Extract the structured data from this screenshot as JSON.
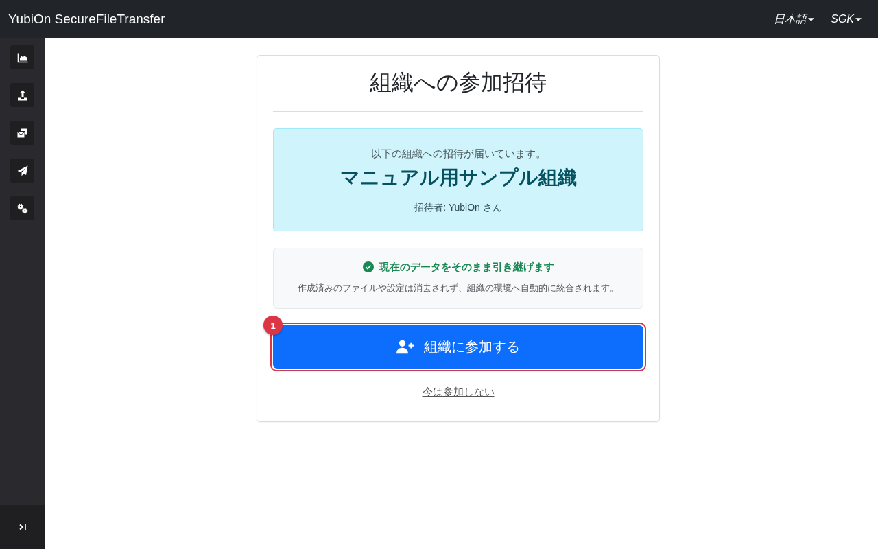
{
  "topbar": {
    "title": "YubiOn SecureFileTransfer",
    "menus": [
      {
        "label": "日本語"
      },
      {
        "label": "SGK"
      }
    ]
  },
  "card": {
    "title": "組織への参加招待",
    "invitation": {
      "intro": "以下の組織への招待が届いています。",
      "organization": "マニュアル用サンプル組織",
      "inviter": "招待者: YubiOn さん"
    },
    "notice": {
      "heading": "現在のデータをそのまま引き継げます",
      "text": "作成済みのファイルや設定は消去されず、組織の環境へ自動的に統合されます。"
    },
    "join_button": {
      "label": "組織に参加する",
      "highlighted": true,
      "badge": "1"
    },
    "decline_link": "今は参加しない"
  }
}
